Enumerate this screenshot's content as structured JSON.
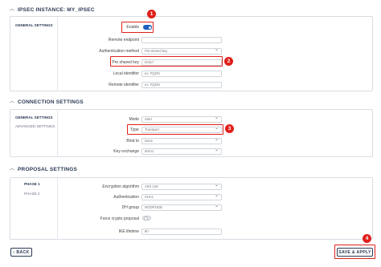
{
  "instance_title": "IPSEC INSTANCE: MY_IPSEC",
  "general": {
    "tab": "GENERAL SETTINGS",
    "enable_label": "Enable",
    "enable_state": "on",
    "remote_endpoint_label": "Remote endpoint",
    "remote_endpoint_value": "",
    "auth_method_label": "Authentication method",
    "auth_method_value": "Pre-shared key",
    "psk_label": "Pre shared key",
    "psk_value": "test17",
    "local_id_label": "Local identifier",
    "local_id_value": "ex. FQDN",
    "remote_id_label": "Remote identifier",
    "remote_id_value": "ex. FQDN"
  },
  "connection": {
    "section_title": "CONNECTION SETTINGS",
    "tab_general": "GENERAL SETTINGS",
    "tab_advanced": "ADVANCED SETTINGS",
    "mode_label": "Mode",
    "mode_value": "Start",
    "type_label": "Type",
    "type_value": "Transport",
    "bind_label": "Bind to",
    "bind_value": "None",
    "key_exchange_label": "Key exchange",
    "key_exchange_value": "IKEv1"
  },
  "proposal": {
    "section_title": "PROPOSAL SETTINGS",
    "tab_phase1": "PHASE 1",
    "tab_phase2": "PHASE 2",
    "enc_label": "Encryption algorithm",
    "enc_value": "AES 128",
    "auth_label": "Authentication",
    "auth_value": "SHA1",
    "dh_label": "DH group",
    "dh_value": "MODP1536",
    "force_label": "Force crypto proposal",
    "force_state": "off",
    "ike_label": "IKE lifetime",
    "ike_value": "8h"
  },
  "footer": {
    "back_label": "BACK",
    "save_label": "SAVE & APPLY"
  },
  "markers": [
    "1",
    "2",
    "3",
    "4"
  ],
  "colors": {
    "accent": "#1f5fbf",
    "highlight": "#e0201b",
    "navy": "#2b3a55"
  }
}
